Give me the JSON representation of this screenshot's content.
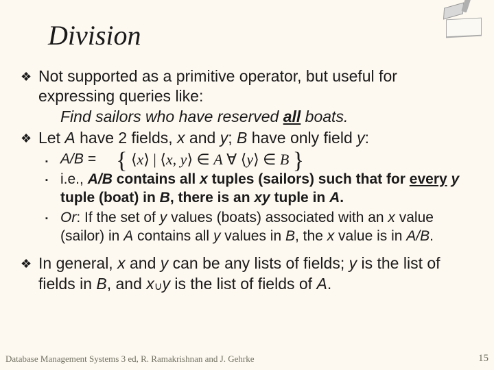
{
  "title": "Division",
  "bullets": {
    "p1a": "Not supported as a primitive operator, but useful for expressing queries like:",
    "p1b_pre": "Find sailors who have reserved ",
    "p1b_all": "all",
    "p1b_post": " boats.",
    "p2_pre": "Let ",
    "p2_A": "A",
    "p2_mid1": " have 2 fields, ",
    "p2_x": "x",
    "p2_and": " and ",
    "p2_y": "y",
    "p2_sc": "; ",
    "p2_B": "B",
    "p2_mid2": " have only field ",
    "p2_y2": "y",
    "p2_colon": ":",
    "s1_label": "A/B = ",
    "s2_a": "i.e., ",
    "s2_b": "A/B",
    "s2_c": " contains all ",
    "s2_d": "x",
    "s2_e": " tuples (sailors) such that for ",
    "s2_f": "every",
    "s2_g": " ",
    "s2_h": "y",
    "s2_i": " tuple (boat) in ",
    "s2_j": "B",
    "s2_k": ", there is an ",
    "s2_l": "xy",
    "s2_m": " tuple in ",
    "s2_n": "A",
    "s2_o": ".",
    "s3_a": "Or",
    "s3_b": ":  If the set of ",
    "s3_c": "y",
    "s3_d": " values (boats) associated with an ",
    "s3_e": "x",
    "s3_f": " value (sailor) in ",
    "s3_g": "A",
    "s3_h": " contains all ",
    "s3_i": "y",
    "s3_j": " values in ",
    "s3_k": "B",
    "s3_l": ", the ",
    "s3_m": "x",
    "s3_n": " value is in ",
    "s3_o": "A/B",
    "s3_p": ".",
    "p4_a": "In general, ",
    "p4_b": "x",
    "p4_c": " and ",
    "p4_d": "y",
    "p4_e": " can be any lists of fields; ",
    "p4_f": "y",
    "p4_g": " is the list of fields in ",
    "p4_h": "B",
    "p4_i": ", and ",
    "p4_j": "x",
    "p4_k": "y",
    "p4_l": " is the list of fields of ",
    "p4_m": "A",
    "p4_n": "."
  },
  "formula": {
    "set_open": "{",
    "lang": "⟨",
    "x": "x",
    "rang": "⟩",
    "bar": " | ",
    "xy": "x, y",
    "in": " ∈ ",
    "A": "A",
    "forall": "  ∀ ",
    "y": "y",
    "B": "B",
    "set_close": "}"
  },
  "cup": "∪",
  "footer": "Database Management Systems 3 ed,  R. Ramakrishnan and J. Gehrke",
  "page": "15",
  "markers": {
    "diamond": "❖",
    "square": "▪"
  }
}
